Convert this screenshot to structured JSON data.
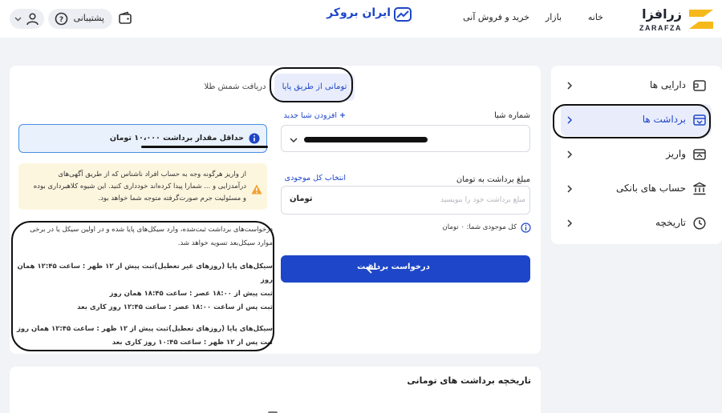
{
  "header": {
    "logo": {
      "name_fa": "زرافزا",
      "name_en": "ZARAFZA"
    },
    "nav": [
      "خانه",
      "بازار",
      "خرید و فروش آنی"
    ],
    "brand": "ایران بروکر",
    "support_label": "پشتیبانی",
    "icons": {
      "wallet": "wallet-icon",
      "support": "support-question-icon",
      "user": "user-icon"
    }
  },
  "sidebar": {
    "items": [
      {
        "label": "دارایی ها",
        "icon": "assets-icon",
        "active": false
      },
      {
        "label": "برداشت ها",
        "icon": "withdraw-icon",
        "active": true
      },
      {
        "label": "واریز",
        "icon": "deposit-icon",
        "active": false
      },
      {
        "label": "حساب های بانکی",
        "icon": "bank-icon",
        "active": false
      },
      {
        "label": "تاریخچه",
        "icon": "history-icon",
        "active": false
      }
    ]
  },
  "tabs": {
    "toman": "تومانی از طریق پایا",
    "gold": "دریافت شمش طلا"
  },
  "form": {
    "sheba_label": "شماره شبا",
    "add_sheba": "افزودن شبا جدید",
    "amount_label": "مبلغ برداشت به تومان",
    "select_all": "انتخاب کل موجودی",
    "amount_placeholder": "مبلغ برداشت خود را بنویسید",
    "amount_unit": "تومان",
    "balance_text": "کل موجودی شما: ۰ تومان",
    "submit_label": "درخواست برداشت"
  },
  "info": {
    "min_withdraw": "حداقل مقدار برداشت ۱۰،۰۰۰ تومان"
  },
  "warning": {
    "text": "از واریز هرگونه وجه به حساب افراد ناشناس که از طریق آگهی‌های درآمدزایی و ... شمارا پیدا کرده‌اند خودداری کنید. این شیوه کلاهبرداری بوده و مسئولیت جرم صورت‌گرفته متوجه شما خواهد بود."
  },
  "notes": {
    "intro": "درخواست‌های برداشت ثبت‌شده، وارد سیکل‌های پایا شده و در اولین سیکل یا در برخی موارد سیکل‌بعد تسویه خواهد شد.",
    "weekday_title": "سیکل‌های پایا (روزهای غیر تعطیل)ثبت پیش از ۱۲ ظهر : ساعت ۱۲:۴۵ همان روز",
    "weekday_line2": "ثبت پیش از ۱۸:۰۰ عصر : ساعت ۱۸:۴۵ همان روز",
    "weekday_line3": "ثبت پس از ساعت ۱۸:۰۰ عصر : ساعت ۱۲:۴۵ روز کاری بعد",
    "holiday_title": "سیکل‌های پایا (روزهای تعطیل)ثبت پیش از ۱۲ ظهر : ساعت ۱۲:۴۵ همان روز",
    "holiday_line2": "ثبت پس از ۱۲ ظهر : ساعت ۱۰:۴۵ روز کاری بعد"
  },
  "history": {
    "title": "تاریخچه برداشت های تومانی"
  },
  "colors": {
    "accent": "#1e46c8",
    "accent_light": "#e9edfb",
    "info_bg": "#e8f1fc",
    "warn_bg": "#fdf6df",
    "warn_icon": "#f0a030",
    "logo_yellow": "#f6b91c"
  }
}
